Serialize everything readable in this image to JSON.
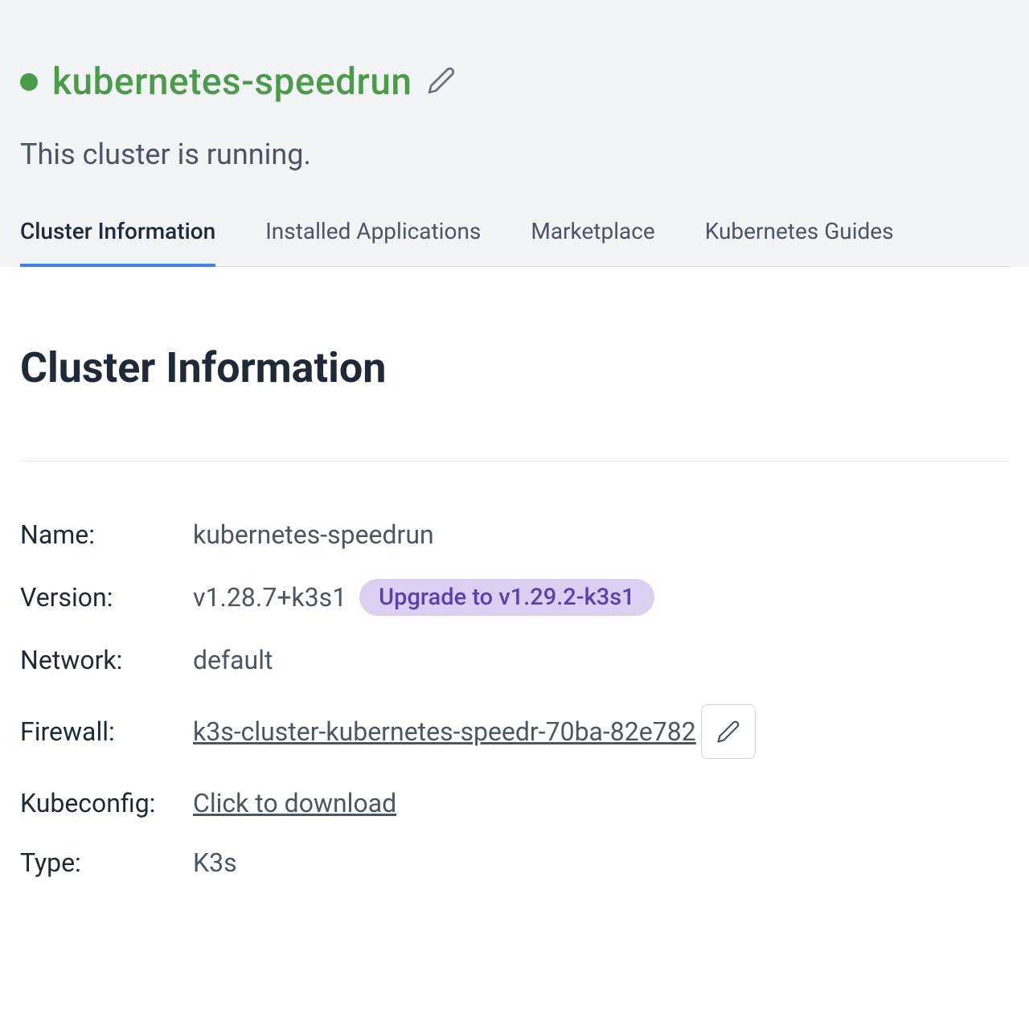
{
  "header": {
    "cluster_name": "kubernetes-speedrun",
    "status_text": "This cluster is running."
  },
  "tabs": [
    {
      "label": "Cluster Information",
      "active": true
    },
    {
      "label": "Installed Applications",
      "active": false
    },
    {
      "label": "Marketplace",
      "active": false
    },
    {
      "label": "Kubernetes Guides",
      "active": false
    }
  ],
  "section": {
    "heading": "Cluster Information"
  },
  "info": {
    "name_label": "Name:",
    "name_value": "kubernetes-speedrun",
    "version_label": "Version:",
    "version_value": "v1.28.7+k3s1",
    "upgrade_badge": "Upgrade to v1.29.2-k3s1",
    "network_label": "Network:",
    "network_value": "default",
    "firewall_label": "Firewall:",
    "firewall_value": "k3s-cluster-kubernetes-speedr-70ba-82e782",
    "kubeconfig_label": "Kubeconfig:",
    "kubeconfig_value": "Click to download",
    "type_label": "Type:",
    "type_value": "K3s"
  }
}
